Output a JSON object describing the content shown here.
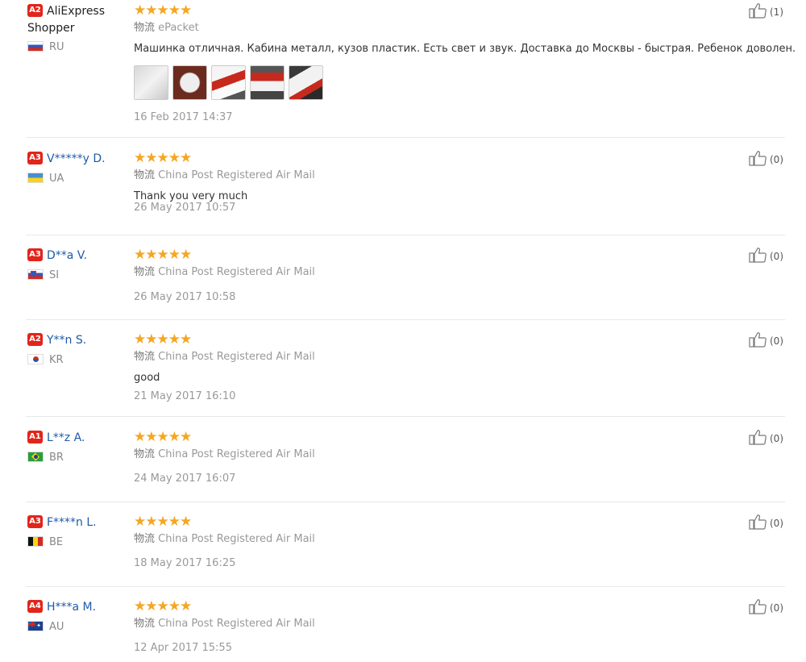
{
  "reviews": [
    {
      "level": "A2",
      "name": "AliExpress Shopper",
      "country": "RU",
      "flag": "flag-ru",
      "stars": "★★★★★",
      "shipping_key": "物流",
      "shipping": "ePacket",
      "comment": "Машинка отличная. Кабина металл, кузов пластик. Есть свет и звук. Доставка до Москвы - быстрая. Ребенок доволен.",
      "photos": 5,
      "date": "16 Feb 2017 14:37",
      "likes": "(1)"
    },
    {
      "level": "A3",
      "name": "V*****y D.",
      "country": "UA",
      "flag": "flag-ua",
      "stars": "★★★★★",
      "shipping_key": "物流",
      "shipping": "China Post Registered Air Mail",
      "comment": "Thank you very much",
      "date": "26 May 2017 10:57",
      "likes": "(0)"
    },
    {
      "level": "A3",
      "name": "D**a V.",
      "country": "SI",
      "flag": "flag-si",
      "stars": "★★★★★",
      "shipping_key": "物流",
      "shipping": "China Post Registered Air Mail",
      "comment": "",
      "date": "26 May 2017 10:58",
      "likes": "(0)"
    },
    {
      "level": "A2",
      "name": "Y**n S.",
      "country": "KR",
      "flag": "flag-kr",
      "stars": "★★★★★",
      "shipping_key": "物流",
      "shipping": "China Post Registered Air Mail",
      "comment": "good",
      "date": "21 May 2017 16:10",
      "likes": "(0)"
    },
    {
      "level": "A1",
      "name": "L**z A.",
      "country": "BR",
      "flag": "flag-br",
      "stars": "★★★★★",
      "shipping_key": "物流",
      "shipping": "China Post Registered Air Mail",
      "comment": "",
      "date": "24 May 2017 16:07",
      "likes": "(0)"
    },
    {
      "level": "A3",
      "name": "F****n L.",
      "country": "BE",
      "flag": "flag-be",
      "stars": "★★★★★",
      "shipping_key": "物流",
      "shipping": "China Post Registered Air Mail",
      "comment": "",
      "date": "18 May 2017 16:25",
      "likes": "(0)"
    },
    {
      "level": "A4",
      "name": "H***a M.",
      "country": "AU",
      "flag": "flag-au",
      "stars": "★★★★★",
      "shipping_key": "物流",
      "shipping": "China Post Registered Air Mail",
      "comment": "",
      "date": "12 Apr 2017 15:55",
      "likes": "(0)"
    }
  ],
  "colors": {
    "accent_level": "#e1251b",
    "star": "#f5a623",
    "name_link": "#1e5aa8"
  },
  "icons": {
    "like": "thumbs-up-icon"
  }
}
